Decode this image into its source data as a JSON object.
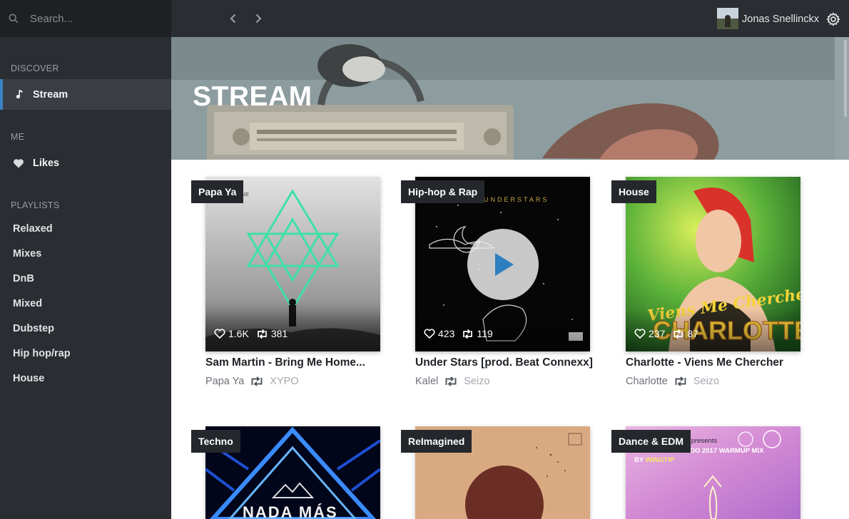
{
  "search": {
    "placeholder": "Search..."
  },
  "sidebar": {
    "discover_label": "DISCOVER",
    "stream_label": "Stream",
    "me_label": "ME",
    "likes_label": "Likes",
    "playlists_label": "PLAYLISTS",
    "playlists": [
      "Relaxed",
      "Mixes",
      "DnB",
      "Mixed",
      "Dubstep",
      "Hip hop/rap",
      "House"
    ]
  },
  "header": {
    "username": "Jonas Snellinckx"
  },
  "banner": {
    "title": "STREAM"
  },
  "cards": [
    {
      "genre": "Papa Ya",
      "likes": "1.6K",
      "reposts": "381",
      "title": "Sam Martin - Bring Me Home...",
      "artist": "Papa Ya",
      "reposter": "XYPO"
    },
    {
      "genre": "Hip-hop & Rap",
      "likes": "423",
      "reposts": "119",
      "title": "Under Stars [prod. Beat Connexx]",
      "artist": "Kalel",
      "reposter": "Seizo"
    },
    {
      "genre": "House",
      "likes": "237",
      "reposts": "87",
      "title": "Charlotte - Viens Me Chercher",
      "artist": "Charlotte",
      "reposter": "Seizo"
    },
    {
      "genre": "Techno"
    },
    {
      "genre": "ReImagined"
    },
    {
      "genre": "Dance & EDM"
    }
  ],
  "cover_text": {
    "c1_tl": "IN\nHOME",
    "c2": "UNDERSTARS",
    "c3a": "Viens Me Chercher",
    "c3b": "CHARLOTTE",
    "c4": "NADA MÁS",
    "c6a": "dancing pineapple presents",
    "c6b": "THE ELECTRIC ZOO 2017 WARMUP MIX",
    "c6c": "BY WINGTIP"
  },
  "colors": {
    "accent": "#3b82c4",
    "sidebar": "#2a2d32",
    "topbar": "#2a2d32"
  }
}
